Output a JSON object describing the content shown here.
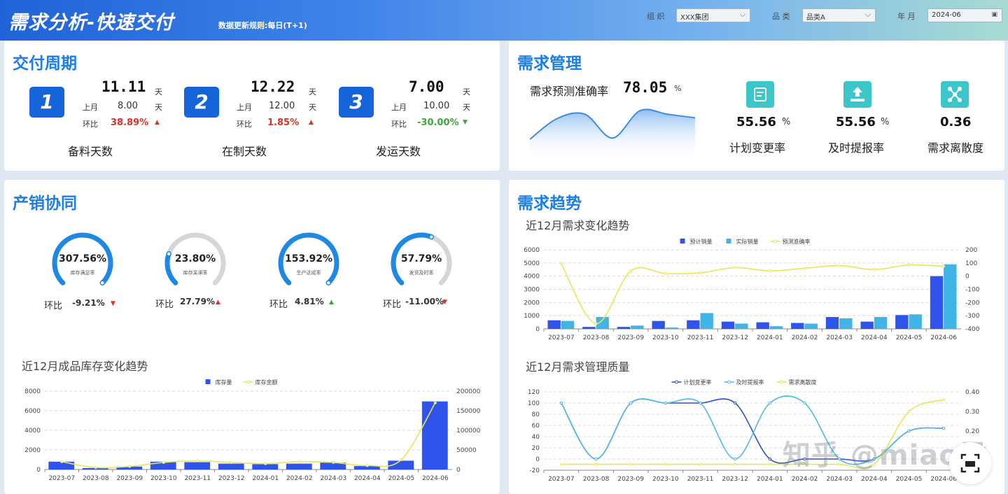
{
  "header": {
    "title": "需求分析-快速交付",
    "subtitle": "数据更新规则:每日(T+1)",
    "filters": [
      {
        "label": "组 织",
        "value": "XXX集团",
        "icon": "chevron-down-icon"
      },
      {
        "label": "品 类",
        "value": "品类A",
        "icon": "chevron-down-icon"
      },
      {
        "label": "年 月",
        "value": "2024-06",
        "icon": "calendar-icon"
      }
    ]
  },
  "delivery": {
    "title": "交付周期",
    "cards": [
      {
        "badge": "1",
        "value": "11.11",
        "unit": "天",
        "last_label": "上月",
        "last_value": "8.00",
        "last_unit": "天",
        "mom_label": "环比",
        "mom_value": "38.89%",
        "trend": "up",
        "name": "备料天数"
      },
      {
        "badge": "2",
        "value": "12.22",
        "unit": "天",
        "last_label": "上月",
        "last_value": "12.00",
        "last_unit": "天",
        "mom_label": "环比",
        "mom_value": "1.85%",
        "trend": "up",
        "name": "在制天数"
      },
      {
        "badge": "3",
        "value": "7.00",
        "unit": "天",
        "last_label": "上月",
        "last_value": "10.00",
        "last_unit": "天",
        "mom_label": "环比",
        "mom_value": "-30.00%",
        "trend": "down",
        "name": "发运天数"
      }
    ]
  },
  "demand_mgmt": {
    "title": "需求管理",
    "accuracy_label": "需求预测准确率",
    "accuracy_value": "78.05",
    "accuracy_unit": "%",
    "kpis": [
      {
        "icon": "edit-plan-icon",
        "value": "55.56",
        "unit": "%",
        "label": "计划变更率"
      },
      {
        "icon": "upload-report-icon",
        "value": "55.56",
        "unit": "%",
        "label": "及时提报率"
      },
      {
        "icon": "scatter-icon",
        "value": "0.36",
        "unit": "",
        "label": "需求离散度"
      }
    ]
  },
  "prod_sales": {
    "title": "产销协同",
    "gauges": [
      {
        "value": "307.56%",
        "label": "库存满足率",
        "fraction": 1.0,
        "color": "#1e88e5",
        "mom_label": "环比",
        "mom_value": "-9.21%",
        "trend": "down"
      },
      {
        "value": "23.80%",
        "label": "库存呆滞率",
        "fraction": 0.238,
        "color": "#1e88e5",
        "mom_label": "环比",
        "mom_value": "27.79%",
        "trend": "up"
      },
      {
        "value": "153.92%",
        "label": "生产达成率",
        "fraction": 1.0,
        "color": "#1e88e5",
        "mom_label": "环比",
        "mom_value": "4.81%",
        "trend": "up"
      },
      {
        "value": "57.79%",
        "label": "发货及时率",
        "fraction": 0.578,
        "color": "#1e88e5",
        "mom_label": "环比",
        "mom_value": "-11.00%",
        "trend": "down"
      }
    ]
  },
  "demand_trend": {
    "title": "需求趋势"
  },
  "chart_data": [
    {
      "id": "accuracy-sparkline",
      "type": "area",
      "x": [
        1,
        2,
        3,
        4,
        5,
        6,
        7
      ],
      "values": [
        20,
        55,
        62,
        22,
        68,
        62,
        56
      ]
    },
    {
      "id": "inventory-chart",
      "type": "bar",
      "title": "近12月成品库存变化趋势",
      "categories": [
        "2023-07",
        "2023-08",
        "2023-09",
        "2023-10",
        "2023-11",
        "2023-12",
        "2024-01",
        "2024-02",
        "2024-03",
        "2024-04",
        "2024-05",
        "2024-06"
      ],
      "ylim": [
        0,
        8000
      ],
      "yticks": [
        0,
        2000,
        4000,
        6000,
        8000
      ],
      "y2lim": [
        0,
        200000
      ],
      "y2ticks": [
        0,
        50000,
        100000,
        150000,
        200000
      ],
      "series": [
        {
          "name": "库存量",
          "type": "bar",
          "color": "#2f54eb",
          "values": [
            800,
            150,
            300,
            800,
            750,
            600,
            550,
            600,
            700,
            350,
            900,
            6950
          ]
        },
        {
          "name": "库存金额",
          "type": "line",
          "axis": "right",
          "color": "#e6e65a",
          "values": [
            20000,
            5000,
            8000,
            18000,
            22000,
            18000,
            15000,
            20000,
            18000,
            10000,
            25000,
            170000
          ]
        }
      ]
    },
    {
      "id": "demand-chart",
      "type": "bar",
      "title": "近12月需求变化趋势",
      "categories": [
        "2023-07",
        "2023-08",
        "2023-09",
        "2023-10",
        "2023-11",
        "2023-12",
        "2024-01",
        "2024-02",
        "2024-03",
        "2024-04",
        "2024-05",
        "2024-06"
      ],
      "ylim": [
        0,
        6000
      ],
      "yticks": [
        0,
        1000,
        2000,
        3000,
        4000,
        5000,
        6000
      ],
      "y2lim": [
        -400,
        200
      ],
      "y2ticks": [
        -400,
        -300,
        -200,
        -100,
        0,
        100,
        200
      ],
      "series": [
        {
          "name": "预计销量",
          "type": "bar",
          "color": "#2f54eb",
          "values": [
            650,
            150,
            150,
            600,
            650,
            550,
            500,
            450,
            900,
            550,
            1050,
            4000
          ]
        },
        {
          "name": "实际销量",
          "type": "bar",
          "color": "#40b4e6",
          "values": [
            600,
            900,
            250,
            100,
            1200,
            400,
            200,
            400,
            800,
            900,
            1100,
            4900
          ]
        },
        {
          "name": "预测准确率",
          "type": "line",
          "axis": "right",
          "color": "#e6e65a",
          "values": [
            95,
            -360,
            40,
            20,
            25,
            65,
            40,
            60,
            80,
            50,
            85,
            75
          ]
        }
      ]
    },
    {
      "id": "quality-chart",
      "type": "line",
      "title": "近12月需求管理质量",
      "categories": [
        "2023-07",
        "2023-08",
        "2023-09",
        "2023-10",
        "2023-11",
        "2023-12",
        "2024-01",
        "2024-02",
        "2024-03",
        "2024-04",
        "2024-05",
        "2024-06"
      ],
      "ylim": [
        -20,
        120
      ],
      "yticks": [
        -20,
        0,
        20,
        40,
        60,
        80,
        100,
        120
      ],
      "y2lim": [
        0,
        0.4
      ],
      "y2ticks": [
        "0.00",
        "0.10",
        "0.20",
        "0.30",
        "0.40"
      ],
      "series": [
        {
          "name": "计划变更率",
          "type": "line",
          "color": "#2e4fc7",
          "values": [
            100,
            0,
            100,
            100,
            100,
            100,
            0,
            0,
            0,
            0,
            50,
            55
          ]
        },
        {
          "name": "及时提报率",
          "type": "line",
          "color": "#52b9e3",
          "values": [
            100,
            0,
            100,
            100,
            100,
            0,
            100,
            100,
            0,
            0,
            50,
            55
          ]
        },
        {
          "name": "需求离散度",
          "type": "line",
          "axis": "right",
          "color": "#e6e65a",
          "values": [
            0.03,
            0.03,
            0.03,
            0.03,
            0.03,
            0.03,
            0.03,
            0.03,
            0.03,
            0.03,
            0.3,
            0.36
          ]
        }
      ]
    }
  ],
  "watermark": "知乎 @miao君",
  "fab_icon": "scan-icon"
}
